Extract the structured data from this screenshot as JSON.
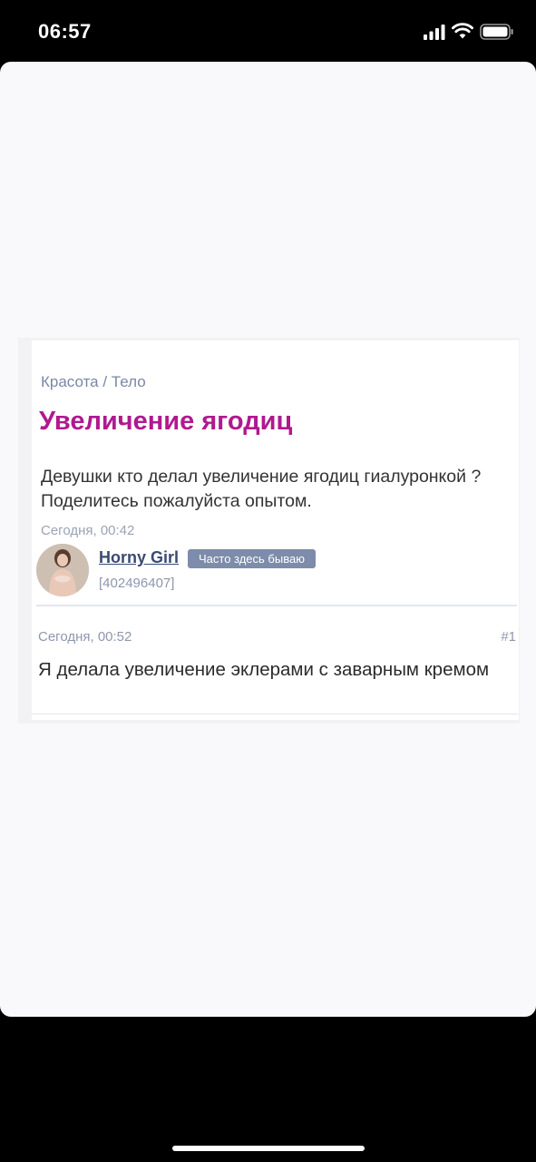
{
  "status_bar": {
    "time": "06:57"
  },
  "post": {
    "breadcrumb": "Красота / Тело",
    "title": "Увеличение ягодиц",
    "body": "Девушки кто делал увеличение ягодиц гиалуронкой ? Поделитесь пожалуйста опытом.",
    "date": "Сегодня, 00:42",
    "author": {
      "name": "Horny Girl",
      "badge": "Часто здесь бываю",
      "id": "[402496407]"
    }
  },
  "reply": {
    "date": "Сегодня, 00:52",
    "number": "#1",
    "body": "Я делала увеличение эклерами с заварным кремом"
  },
  "colors": {
    "title": "#b0198f",
    "meta": "#8d97ad",
    "badge_bg": "#7d8cab",
    "author_link": "#3a4a73"
  }
}
